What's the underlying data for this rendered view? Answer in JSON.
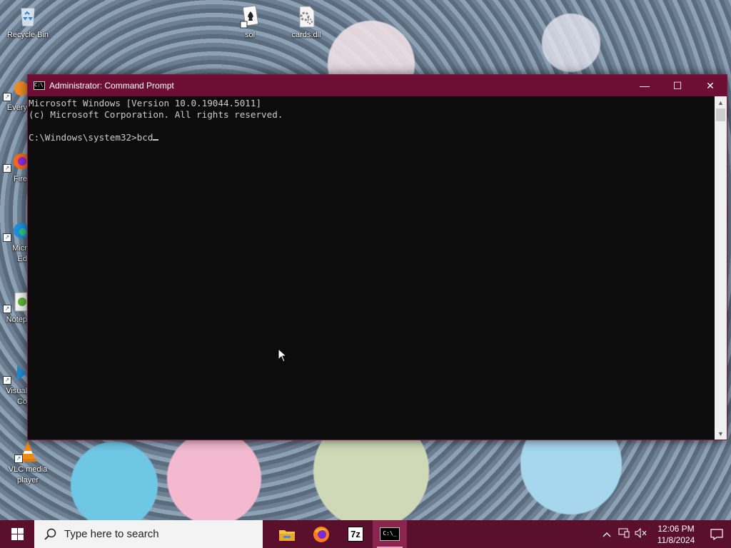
{
  "desktop": {
    "icons": [
      {
        "label": "Recycle Bin"
      },
      {
        "label": "sol"
      },
      {
        "label": "cards.dll"
      },
      {
        "label": "Every"
      },
      {
        "label": "Fire"
      },
      {
        "label_line1": "Micr",
        "label_line2": "Ed"
      },
      {
        "label": "Notep"
      },
      {
        "label_line1": "Visual",
        "label_line2": "Co"
      },
      {
        "label_line1": "VLC media",
        "label_line2": "player"
      }
    ]
  },
  "window": {
    "title": "Administrator: Command Prompt",
    "icon_glyph": "C:\\",
    "controls": {
      "minimize": "—",
      "maximize": "☐",
      "close": "✕"
    },
    "console": {
      "line1": "Microsoft Windows [Version 10.0.19044.5011]",
      "line2": "(c) Microsoft Corporation. All rights reserved.",
      "line3": "",
      "prompt": "C:\\Windows\\system32>",
      "input": "bcd"
    }
  },
  "taskbar": {
    "search_placeholder": "Type here to search",
    "apps": [
      {
        "name": "file-explorer",
        "running": false
      },
      {
        "name": "firefox",
        "running": false
      },
      {
        "name": "7zip",
        "glyph": "7z",
        "running": false
      },
      {
        "name": "command-prompt",
        "glyph": "C:\\_",
        "running": true,
        "active": true
      }
    ],
    "tray": {
      "chevron": "^",
      "time": "12:06 PM",
      "date": "11/8/2024"
    }
  },
  "colors": {
    "accent": "#6d0f35",
    "taskbar": "#5a0f2c",
    "console_bg": "#0c0c0c",
    "console_fg": "#cccccc"
  }
}
